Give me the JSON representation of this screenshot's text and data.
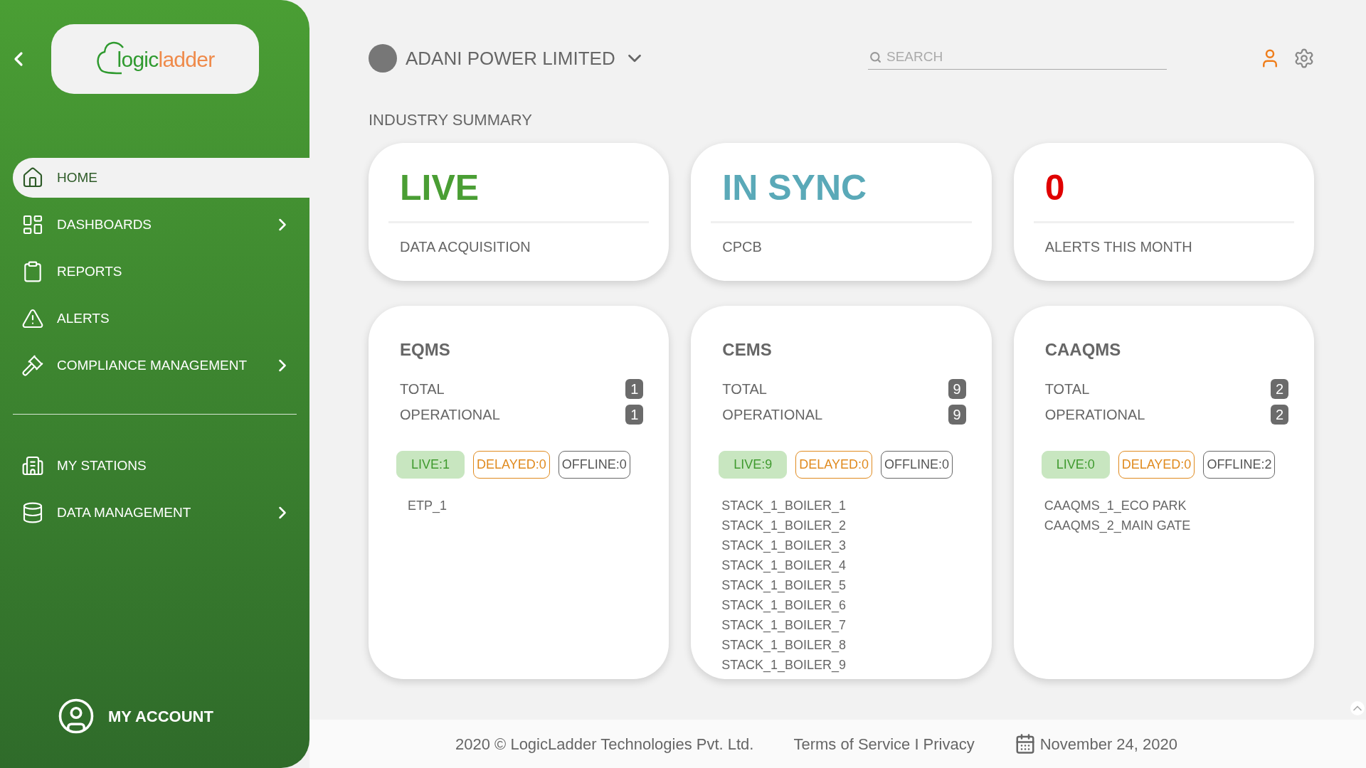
{
  "logo": {
    "part1": "logic",
    "part2": "ladder"
  },
  "sidebar": {
    "items": [
      {
        "label": "HOME",
        "selected": true,
        "expandable": false
      },
      {
        "label": "DASHBOARDS",
        "selected": false,
        "expandable": true
      },
      {
        "label": "REPORTS",
        "selected": false,
        "expandable": false
      },
      {
        "label": "ALERTS",
        "selected": false,
        "expandable": false
      },
      {
        "label": "COMPLIANCE MANAGEMENT",
        "selected": false,
        "expandable": true
      }
    ],
    "items_2": [
      {
        "label": "MY STATIONS",
        "selected": false,
        "expandable": false
      },
      {
        "label": "DATA MANAGEMENT",
        "selected": false,
        "expandable": true
      }
    ],
    "account": "MY ACCOUNT"
  },
  "header": {
    "company": "ADANI POWER LIMITED",
    "search": {
      "placeholder": "SEARCH"
    }
  },
  "section_title": "INDUSTRY SUMMARY",
  "summary_cards": [
    {
      "value": "LIVE",
      "label": "DATA ACQUISITION",
      "color": "#4a9e34"
    },
    {
      "value": "IN SYNC",
      "label": "CPCB",
      "color": "#5aa9b8"
    },
    {
      "value": "0",
      "label": "ALERTS THIS MONTH",
      "color": "#e00000"
    }
  ],
  "systems": [
    {
      "title": "EQMS",
      "total_label": "TOTAL",
      "total": "1",
      "operational_label": "OPERATIONAL",
      "operational": "1",
      "chips": [
        {
          "kind": "live",
          "label": "LIVE:1"
        },
        {
          "kind": "delayed",
          "label": "DELAYED:0"
        },
        {
          "kind": "offline",
          "label": "OFFLINE:0"
        }
      ],
      "stations": [
        "ETP_1"
      ]
    },
    {
      "title": "CEMS",
      "total_label": "TOTAL",
      "total": "9",
      "operational_label": "OPERATIONAL",
      "operational": "9",
      "chips": [
        {
          "kind": "live",
          "label": "LIVE:9"
        },
        {
          "kind": "delayed",
          "label": "DELAYED:0"
        },
        {
          "kind": "offline",
          "label": "OFFLINE:0"
        }
      ],
      "stations": [
        "STACK_1_BOILER_1",
        "STACK_1_BOILER_2",
        "STACK_1_BOILER_3",
        "STACK_1_BOILER_4",
        "STACK_1_BOILER_5",
        "STACK_1_BOILER_6",
        "STACK_1_BOILER_7",
        "STACK_1_BOILER_8",
        "STACK_1_BOILER_9"
      ]
    },
    {
      "title": "CAAQMS",
      "total_label": "TOTAL",
      "total": "2",
      "operational_label": "OPERATIONAL",
      "operational": "2",
      "chips": [
        {
          "kind": "live",
          "label": "LIVE:0"
        },
        {
          "kind": "delayed",
          "label": "DELAYED:0"
        },
        {
          "kind": "offline",
          "label": "OFFLINE:2"
        }
      ],
      "stations": [
        "CAAQMS_1_ECO PARK",
        "CAAQMS_2_MAIN GATE"
      ]
    }
  ],
  "footer": {
    "copyright": "2020 © LogicLadder Technologies Pvt. Ltd.",
    "terms": "Terms of Service I Privacy",
    "date": "November 24, 2020"
  }
}
